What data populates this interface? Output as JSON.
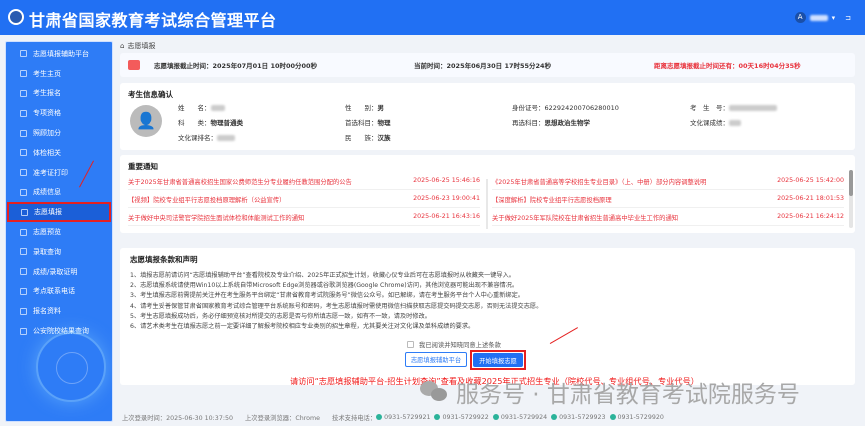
{
  "header": {
    "title": "甘肃省国家教育考试综合管理平台",
    "user_avatar_letter": "A",
    "logout_icon": "logout-icon"
  },
  "sidebar": {
    "items": [
      {
        "label": "志愿填报辅助平台"
      },
      {
        "label": "考生主页"
      },
      {
        "label": "考生报名"
      },
      {
        "label": "专项资格"
      },
      {
        "label": "照顾加分"
      },
      {
        "label": "体检相关"
      },
      {
        "label": "准考证打印"
      },
      {
        "label": "成绩信息"
      },
      {
        "label": "志愿填报",
        "active": true
      },
      {
        "label": "志愿预览"
      },
      {
        "label": "录取查询"
      },
      {
        "label": "成绩/录取证明"
      },
      {
        "label": "考点联系电话"
      },
      {
        "label": "报名资料"
      },
      {
        "label": "公安院校结果查询"
      }
    ]
  },
  "breadcrumb": "志愿填报",
  "deadline": {
    "end": "志愿填报截止时间：2025年07月01日 10时00分00秒",
    "now": "当前时间：2025年06月30日 17时55分24秒",
    "remain": "距离志愿填报截止时间还有：00天16时04分35秒"
  },
  "info": {
    "title": "考生信息确认",
    "name_label": "姓　　名：",
    "subject_label": "科　　类：",
    "subject": "物理普通类",
    "rank_label": "文化课排名：",
    "gender_label": "性　　别：",
    "gender": "男",
    "first_label": "首选科目：",
    "first": "物理",
    "nation_label": "民　　族：",
    "nation": "汉族",
    "id_label": "身份证号：",
    "id": "622924200706280010",
    "second_label": "再选科目：",
    "second": "思想政治生物学",
    "exam_no_label": "考　生　号：",
    "score_label": "文化课成绩："
  },
  "notice": {
    "title": "重要通知",
    "left": [
      {
        "text": "关于2025年甘肃省普通高校招生国家公费师范生分专业履约任教范围分配的公告",
        "time": "2025-06-25 15:46:16"
      },
      {
        "text": "【视频】院校专业组平行志愿投档原理解析（公益宣传）",
        "time": "2025-06-23 19:00:41"
      },
      {
        "text": "关于做好中央司法警官学院招生面试体检和体能测试工作的通知",
        "time": "2025-06-21 16:43:16"
      }
    ],
    "right": [
      {
        "text": "《2025年甘肃省普通高等学校招生专业目录》（上、中册）部分内容调整说明",
        "time": "2025-06-25 15:42:00"
      },
      {
        "text": "【深度解析】院校专业组平行志愿投档原理",
        "time": "2025-06-21 18:01:53"
      },
      {
        "text": "关于做好2025年军队院校在甘肃省招生普通高中毕业生工作的通知",
        "time": "2025-06-21 16:24:12"
      }
    ]
  },
  "terms": {
    "title": "志愿填报条款和声明",
    "items": [
      "1、填报志愿前请访问“志愿填报辅助平台”查看院校及专业介绍、2025年正式招生计划，收藏心仪专业后可在志愿填报时从收藏夹一键导入。",
      "2、志愿填报系统请使用Win10以上系统自带Microsoft Edge浏览器或谷歌浏览器(Google Chrome)访问，其他浏览器可能出现不兼容情况。",
      "3、考生填报志愿前需提前关注并在考生服务平台绑定“甘肃省教育考试院服务号”微信公众号。如已解绑，请在考生服务平台个人中心重新绑定。",
      "4、请考生妥善保管甘肃省国家教育考试综合管理平台系统账号和密码，考生志愿填报时需使用微信扫描获取志愿提交码提交志愿，否则无法提交志愿。",
      "5、考生志愿填报成功后，务必仔细预览核对所提交的志愿是否与你所填志愿一致，如有不一致，请及时修改。",
      "6、请艺术类考生在填报志愿之前一定要详细了解报考院校相应专业类别的招生章程，尤其要关注对文化课及单科成绩的要求。"
    ],
    "agree": "我已阅读并知晓同意上述条款",
    "btn_platform": "志愿填报辅助平台",
    "btn_start": "开始填报志愿"
  },
  "annotation": "请访问“志愿填报辅助平台-招生计划查询”查看及收藏2025年正式招生专业（院校代号、专业组代号、专业代号）",
  "watermark": "服务号 · 甘肃省教育考试院服务号",
  "footer": {
    "last_login": "上次登录时间：2025-06-30 10:37:50",
    "browser": "上次登录浏览器：Chrome",
    "support": "技术支持电话：",
    "phones": [
      "0931-5729921",
      "0931-5729922",
      "0931-5729924",
      "0931-5729923",
      "0931-5729920"
    ]
  },
  "colors": {
    "primary": "#2170f3",
    "alert": "#e8323c",
    "highlight": "#e52020"
  }
}
